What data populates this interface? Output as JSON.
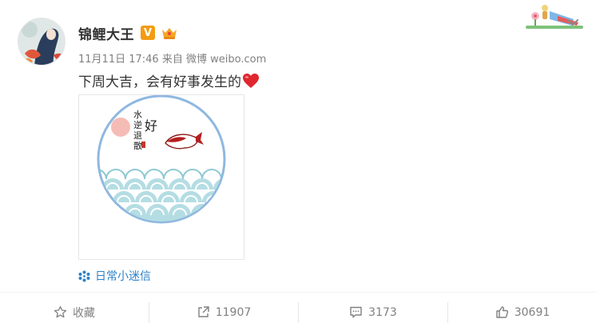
{
  "post": {
    "author": "锦鲤大王",
    "verified_badge": "V",
    "meta": {
      "datetime": "11月11日 17:46",
      "source_prefix": "来自",
      "source": "微博 weibo.com"
    },
    "text": "下周大吉，会有好事发生的",
    "image": {
      "calligraphy_vertical": [
        "水",
        "逆",
        "退",
        "散"
      ],
      "calligraphy_big": "好"
    },
    "topic_link": "日常小迷信"
  },
  "actions": {
    "favorite_label": "收藏",
    "repost_count": "11907",
    "comment_count": "3173",
    "like_count": "30691"
  },
  "icons": {
    "verified": "verified-v-icon",
    "vip": "vip-crown-icon",
    "heart": "red-heart-emoji-icon",
    "topic": "topic-flower-icon",
    "favorite": "star-icon",
    "repost": "share-arrow-icon",
    "comment": "comment-bubble-icon",
    "like": "thumb-up-icon",
    "more": "chevron-down-icon"
  },
  "colors": {
    "link": "#2b82c8",
    "verified": "#f39c12",
    "heart": "#e0262f",
    "text": "#333333",
    "muted": "#808080"
  }
}
